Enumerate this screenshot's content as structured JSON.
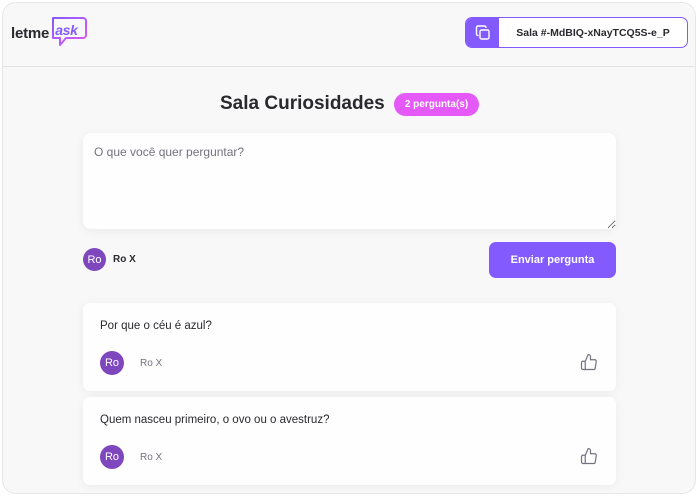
{
  "logo": {
    "letme": "letme",
    "ask": "ask"
  },
  "header": {
    "room_code": "Sala #-MdBIQ-xNayTCQ5S-e_P",
    "copy_icon": "copy-icon"
  },
  "room": {
    "title": "Sala Curiosidades",
    "question_count": "2 pergunta(s)"
  },
  "form": {
    "placeholder": "O que você quer perguntar?",
    "value": "",
    "send_label": "Enviar pergunta"
  },
  "user": {
    "initials": "Ro",
    "name": "Ro X"
  },
  "questions": [
    {
      "content": "Por que o céu é azul?",
      "author_initials": "Ro",
      "author": "Ro X",
      "like_icon": "thumbs-up-icon"
    },
    {
      "content": "Quem nasceu primeiro, o ovo ou o avestruz?",
      "author_initials": "Ro",
      "author": "Ro X",
      "like_icon": "thumbs-up-icon"
    }
  ],
  "colors": {
    "accent": "#835afd",
    "badge": "#e559f9",
    "avatar": "#7e47be",
    "background": "#f8f8f8"
  }
}
